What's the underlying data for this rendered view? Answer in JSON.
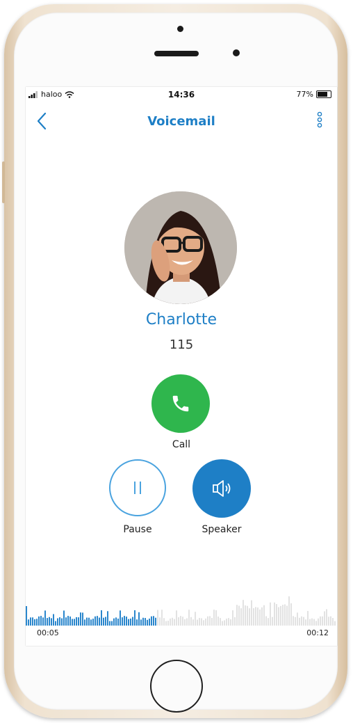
{
  "status_bar": {
    "carrier": "haloo",
    "time": "14:36",
    "battery": "77%",
    "battery_level": 0.77
  },
  "nav": {
    "title": "Voicemail",
    "back_icon": "chevron-left-icon",
    "more_icon": "more-vertical-icon"
  },
  "contact": {
    "name": "Charlotte",
    "number": "115"
  },
  "actions": {
    "call_label": "Call",
    "pause_label": "Pause",
    "speaker_label": "Speaker"
  },
  "playback": {
    "elapsed": "00:05",
    "total": "00:12",
    "progress": 0.42
  },
  "colors": {
    "accent": "#1e7fc6",
    "call_green": "#2fb64d",
    "wave_played": "#2a86cc",
    "wave_remaining": "#e2e2e2"
  }
}
